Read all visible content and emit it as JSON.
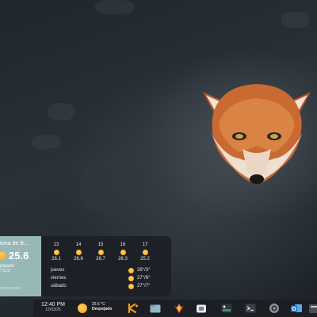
{
  "weather": {
    "location": "toria de B...",
    "current_temp": "25.6",
    "condition": "pejado",
    "minmax": "°/5.5°",
    "source": "vmoan.com",
    "hourly": [
      {
        "hour": "13",
        "temp": "26.1",
        "icon": "sun-icon"
      },
      {
        "hour": "14",
        "temp": "26.6",
        "icon": "sun-icon"
      },
      {
        "hour": "15",
        "temp": "26.7",
        "icon": "sun-icon"
      },
      {
        "hour": "16",
        "temp": "26.3",
        "icon": "sun-icon"
      },
      {
        "hour": "17",
        "temp": "25.2",
        "icon": "sun-icon"
      }
    ],
    "daily": [
      {
        "day": "jueves",
        "temps": "28°/3°",
        "icon": "sun-icon"
      },
      {
        "day": "viernes",
        "temps": "27°/6°",
        "icon": "sun-icon"
      },
      {
        "day": "sábado",
        "temps": "27°/7°",
        "icon": "sun-icon"
      }
    ]
  },
  "taskbar": {
    "time": "12:40 PM",
    "date": "12/03/25",
    "weather_temp": "25.6 °C",
    "weather_condition": "Despejado",
    "apps": [
      {
        "name": "kde-icon",
        "color": "#f2a01e"
      },
      {
        "name": "file-manager-icon",
        "color": "#8fb6c9"
      },
      {
        "name": "firefox-icon",
        "color": "#e8762b"
      },
      {
        "name": "store-icon",
        "color": "#e9e9ef"
      },
      {
        "name": "system-monitor-icon",
        "color": "#2f9e62"
      },
      {
        "name": "terminal-icon",
        "color": "#3a3f47"
      },
      {
        "name": "settings-icon",
        "color": "#8a8f98"
      },
      {
        "name": "outlook-icon",
        "color": "#1b72c4"
      },
      {
        "name": "files-icon",
        "color": "#4a4f58"
      }
    ]
  }
}
